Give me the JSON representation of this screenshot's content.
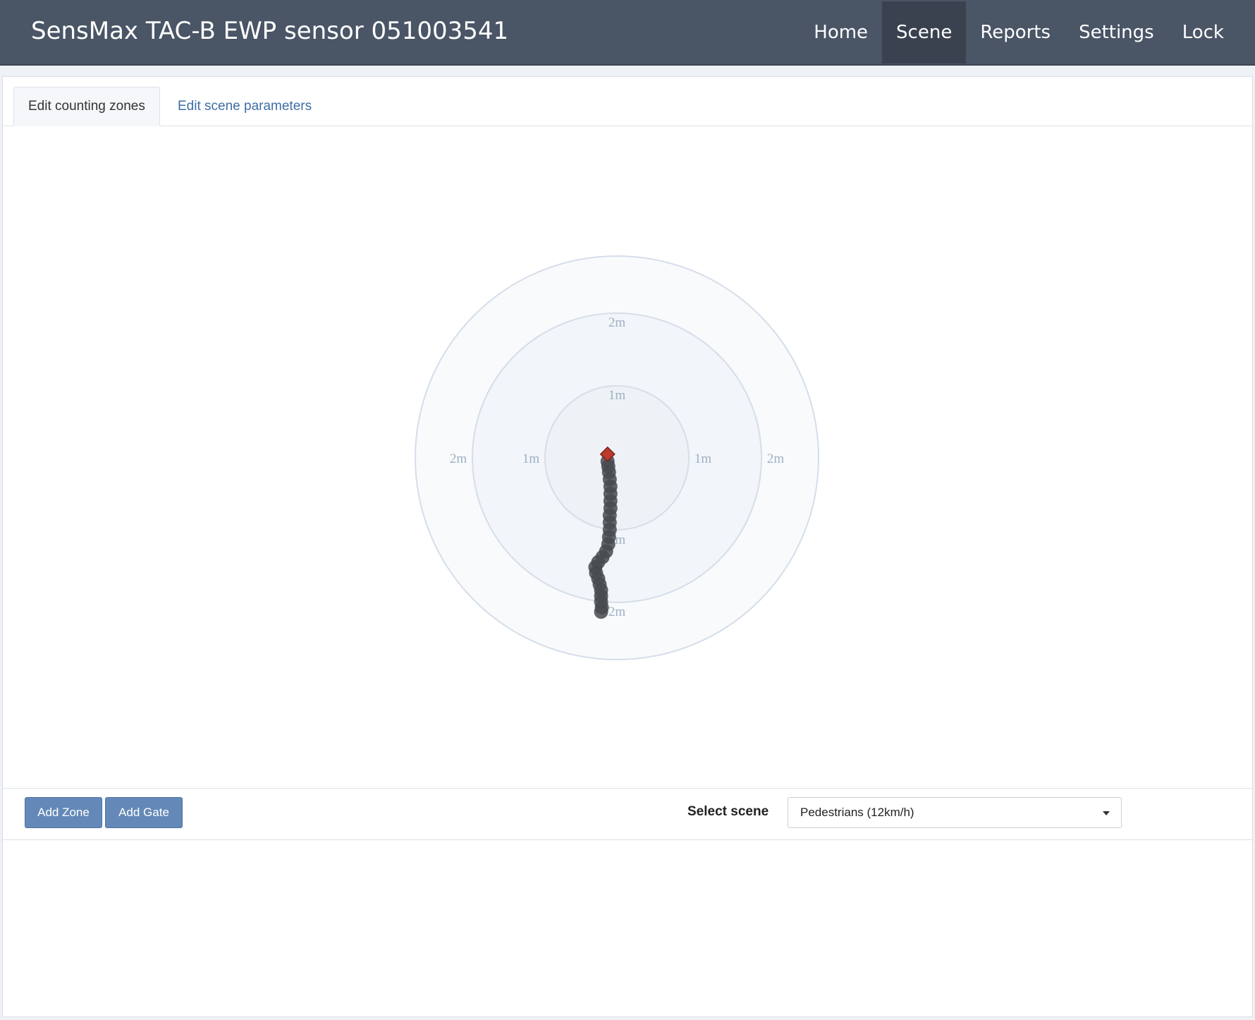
{
  "header": {
    "title": "SensMax TAC-B EWP sensor 051003541",
    "nav": [
      {
        "label": "Home",
        "active": false
      },
      {
        "label": "Scene",
        "active": true
      },
      {
        "label": "Reports",
        "active": false
      },
      {
        "label": "Settings",
        "active": false
      },
      {
        "label": "Lock",
        "active": false
      }
    ]
  },
  "tabs": [
    {
      "label": "Edit counting zones",
      "active": true
    },
    {
      "label": "Edit scene parameters",
      "active": false
    }
  ],
  "radar": {
    "ring_labels": {
      "outer": "2m",
      "inner": "1m"
    },
    "colors": {
      "ring_stroke": "#d5deea",
      "outer_fill": "#f8fafc",
      "inner_fill": "#f2f5f9",
      "center_fill": "#eef2f6",
      "label": "#9eb0c4",
      "track": "#474a4f",
      "target": "#b93a2e"
    },
    "track_points": [
      [
        -0.13,
        0.05
      ],
      [
        -0.12,
        0.12
      ],
      [
        -0.11,
        0.2
      ],
      [
        -0.1,
        0.3
      ],
      [
        -0.09,
        0.4
      ],
      [
        -0.09,
        0.5
      ],
      [
        -0.09,
        0.6
      ],
      [
        -0.09,
        0.7
      ],
      [
        -0.1,
        0.8
      ],
      [
        -0.1,
        0.9
      ],
      [
        -0.1,
        1.0
      ],
      [
        -0.11,
        1.1
      ],
      [
        -0.12,
        1.2
      ],
      [
        -0.15,
        1.3
      ],
      [
        -0.2,
        1.38
      ],
      [
        -0.26,
        1.45
      ],
      [
        -0.3,
        1.52
      ],
      [
        -0.29,
        1.6
      ],
      [
        -0.26,
        1.68
      ],
      [
        -0.24,
        1.76
      ],
      [
        -0.22,
        1.84
      ],
      [
        -0.22,
        1.92
      ],
      [
        -0.22,
        2.0
      ],
      [
        -0.21,
        2.08
      ],
      [
        -0.22,
        2.14
      ]
    ],
    "target_point": [
      -0.13,
      -0.05
    ]
  },
  "toolbar": {
    "add_zone_label": "Add Zone",
    "add_gate_label": "Add Gate",
    "select_scene_label": "Select scene",
    "scene_value": "Pedestrians (12km/h)"
  }
}
